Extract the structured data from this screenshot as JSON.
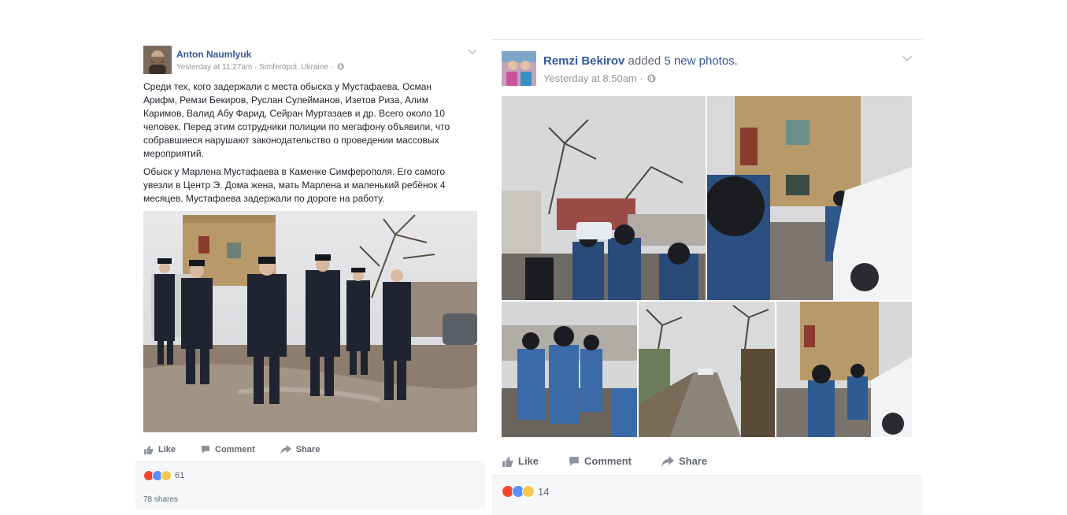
{
  "post1": {
    "author": "Anton Naumlyuk",
    "meta": "Yesterday at 11:27am · Simferopol, Ukraine ·",
    "paragraphs": [
      "Среди тех, кого задержали с места обыска у Мустафаева, Осман Арифм, Ремзи Бекиров, Руслан Сулейманов, Изетов Риза, Алим Каримов, Валид Абу Фарид, Сейран Муртазаев и др. Всего около 10 человек. Перед этим сотрудники полиции по мегафону объявили, что собравшиеся нарушают законодательство о проведении массовых мероприятий.",
      "Обыск у Марлена Мустафаева в Каменке Симферополя. Его самого увезли в Центр Э. Дома жена, мать Марлена и маленький ребёнок 4 месяцев. Мустафаева задержали по дороге на работу."
    ],
    "actions": {
      "like": "Like",
      "comment": "Comment",
      "share": "Share"
    },
    "reaction_count": "61",
    "shares": "78 shares"
  },
  "post2": {
    "author": "Remzi Bekirov",
    "action_text": "added",
    "action_link": "5 new photos.",
    "meta": "Yesterday at 8:50am ·",
    "actions": {
      "like": "Like",
      "comment": "Comment",
      "share": "Share"
    },
    "reaction_count": "14"
  },
  "icons": {
    "globe": "globe-icon",
    "chevron": "chevron-down-icon",
    "like": "thumbs-up-icon",
    "comment": "comment-icon",
    "share": "share-arrow-icon"
  },
  "colors": {
    "link": "#365899",
    "meta": "#90949c",
    "action": "#616770",
    "angry": "#f0472e",
    "like": "#5890ff",
    "sad": "#f7c74f"
  }
}
